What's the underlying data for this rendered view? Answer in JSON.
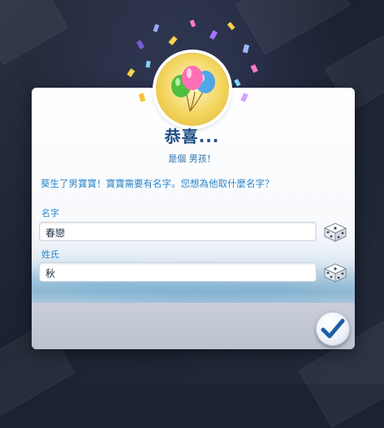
{
  "dialog": {
    "title": "恭喜...",
    "subtitle": "是個 男孩！",
    "message": "葵生了男寶寶！寶寶需要有名字。您想為他取什麼名字？",
    "first_name_label": "名字",
    "first_name_value": "春戀",
    "last_name_label": "姓氏",
    "last_name_value": "秋"
  },
  "icons": {
    "badge": "balloons-icon",
    "randomize": "dice-icon",
    "confirm": "checkmark-icon"
  },
  "colors": {
    "title": "#1e4d86",
    "accent_text": "#2a86c9",
    "confirm_check": "#1f5fa6"
  }
}
